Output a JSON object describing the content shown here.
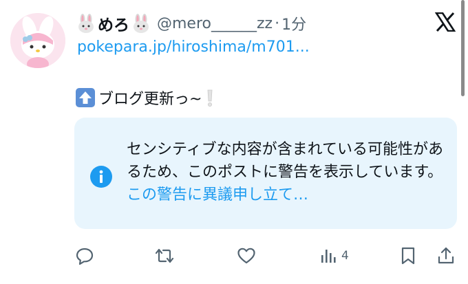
{
  "tweet": {
    "display_name": "めろ",
    "handle": "@mero______zz",
    "separator": "·",
    "time": "1分",
    "link": "pokepara.jp/hiroshima/m701...",
    "text": "ブログ更新っ~"
  },
  "warning": {
    "message": "センシティブな内容が含まれている可能性があるため、このポストに警告を表示しています。",
    "appeal_label": "この警告に異議申し立て…"
  },
  "actions": {
    "views_count": "4"
  },
  "icons": {
    "logo": "x-logo-icon",
    "up_arrow": "up-arrow-emoji-icon",
    "exclamation": "white-exclamation-emoji-icon",
    "info": "info-icon",
    "reply": "reply-icon",
    "repost": "repost-icon",
    "like": "heart-icon",
    "views": "views-icon",
    "bookmark": "bookmark-icon",
    "share": "share-icon"
  },
  "colors": {
    "accent": "#1d9bf0",
    "secondary_text": "#536471",
    "warning_bg": "#e8f5fd",
    "avatar_bg": "#fbe4ee"
  }
}
